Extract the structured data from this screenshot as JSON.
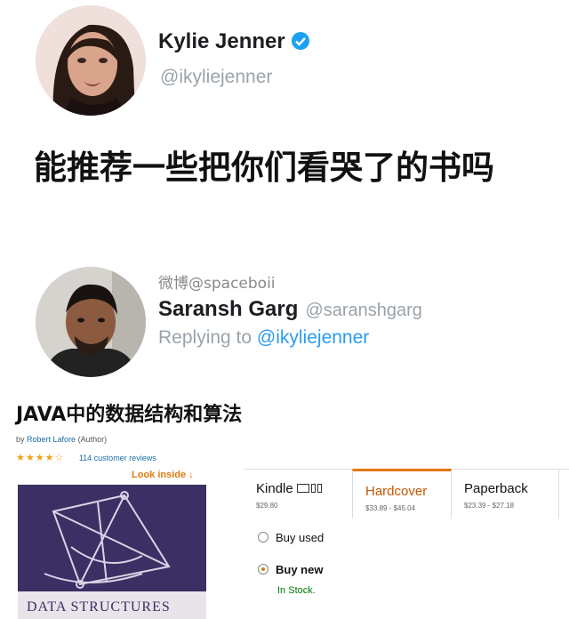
{
  "tweet": {
    "author_name": "Kylie Jenner",
    "author_handle": "@ikyliejenner",
    "verified_icon": "verified-badge-icon",
    "text": "能推荐一些把你们看哭了的书吗"
  },
  "reply": {
    "watermark": "微博@spaceboii",
    "author_name": "Saransh Garg",
    "author_handle": "@saranshgarg",
    "replying_prefix": "Replying to",
    "replying_to": "@ikyliejenner",
    "text": "JAVA中的数据结构和算法"
  },
  "product": {
    "byline_prefix": "by",
    "author": "Robert Lafore",
    "author_role": "(Author)",
    "stars": "★★★★☆",
    "reviews": "114 customer reviews",
    "look_inside": "Look inside ↓",
    "book_cover_title": "DATA STRUCTURES",
    "formats": [
      {
        "name": "Kindle",
        "price": "$29.80"
      },
      {
        "name": "Hardcover",
        "price": "$33.89 - $45.04"
      },
      {
        "name": "Paperback",
        "price": "$23.39 - $27.18"
      }
    ],
    "options": {
      "used": "Buy used",
      "new": "Buy new",
      "stock": "In Stock."
    }
  },
  "colors": {
    "link_blue": "#2b9bf0",
    "amazon_orange": "#e47911",
    "cover_purple": "#3b2f64"
  }
}
